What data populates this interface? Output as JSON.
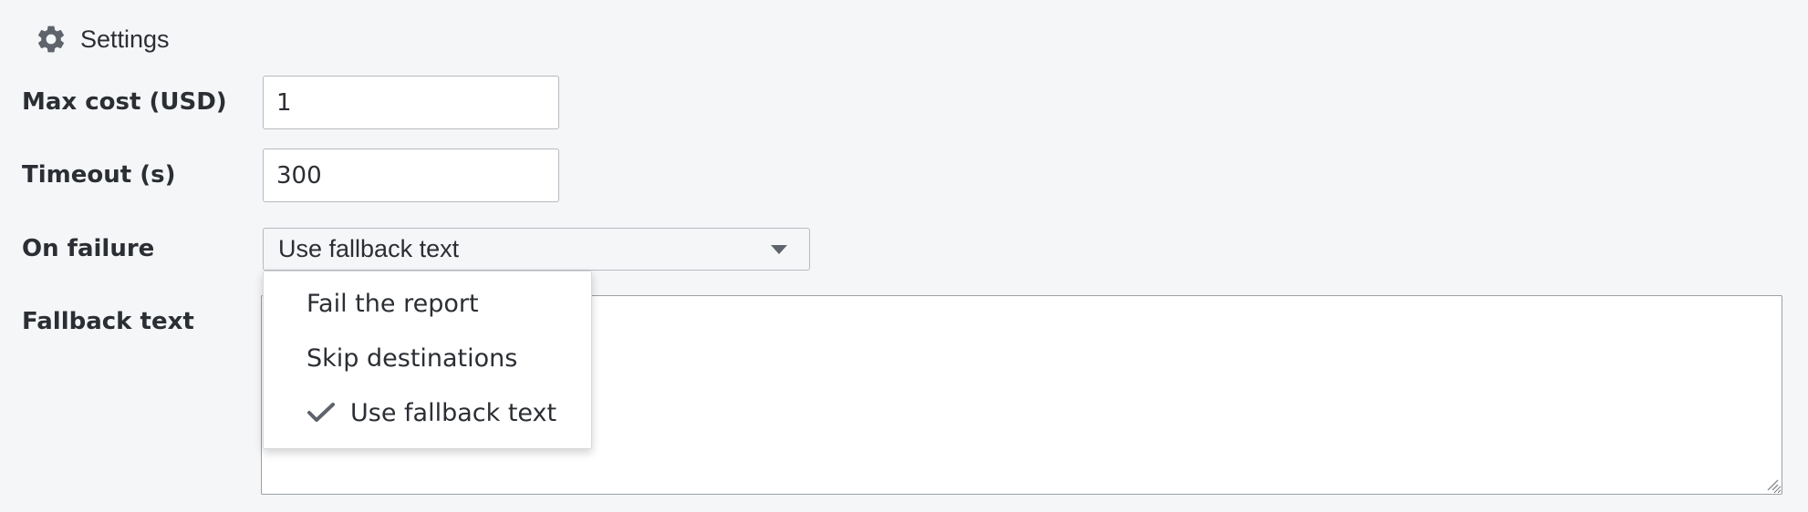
{
  "header": {
    "icon": "gear-icon",
    "title": "Settings"
  },
  "fields": {
    "max_cost": {
      "label": "Max cost (USD)",
      "value": "1"
    },
    "timeout": {
      "label": "Timeout (s)",
      "value": "300"
    },
    "on_failure": {
      "label": "On failure",
      "selected": "Use fallback text",
      "options": [
        {
          "label": "Fail the report",
          "selected": false
        },
        {
          "label": "Skip destinations",
          "selected": false
        },
        {
          "label": "Use fallback text",
          "selected": true,
          "icon": "check-icon"
        }
      ]
    },
    "fallback_text": {
      "label": "Fallback text",
      "value": ""
    }
  },
  "colors": {
    "background": "#f5f6f8",
    "text": "#2b2e33",
    "icon": "#5f646c",
    "border": "#b7babf"
  }
}
